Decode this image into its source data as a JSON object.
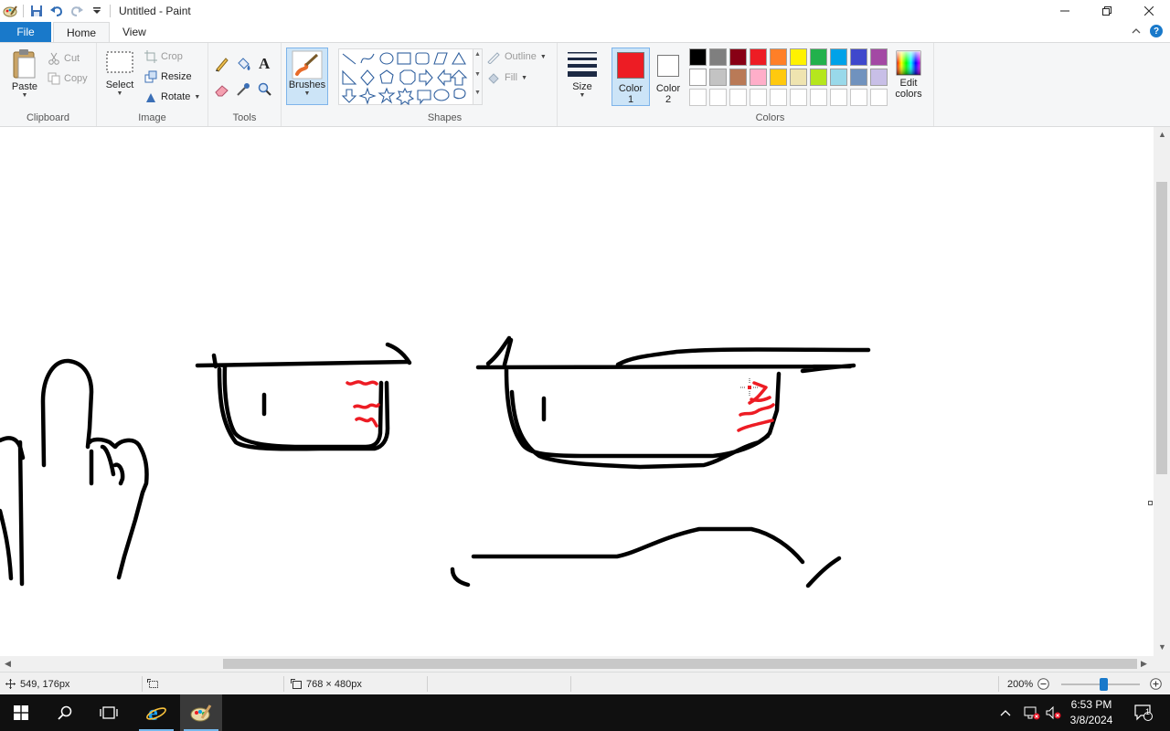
{
  "window": {
    "title": "Untitled - Paint"
  },
  "tabs": [
    "File",
    "Home",
    "View"
  ],
  "ribbon": {
    "clipboard": {
      "label": "Clipboard",
      "paste": "Paste",
      "cut": "Cut",
      "copy": "Copy"
    },
    "image": {
      "label": "Image",
      "select": "Select",
      "crop": "Crop",
      "resize": "Resize",
      "rotate": "Rotate"
    },
    "tools": {
      "label": "Tools"
    },
    "brushes": {
      "label": "Brushes"
    },
    "shapes": {
      "label": "Shapes",
      "outline": "Outline",
      "fill": "Fill"
    },
    "size": {
      "label": "Size"
    },
    "colors": {
      "label": "Colors",
      "color1": "Color 1",
      "color1_line1": "Color",
      "color1_line2": "1",
      "color2_line1": "Color",
      "color2_line2": "2",
      "color1_value": "#ed1c24",
      "color2_value": "#ffffff",
      "edit_line1": "Edit",
      "edit_line2": "colors",
      "palette_row1": [
        "#000000",
        "#7f7f7f",
        "#880015",
        "#ed1c24",
        "#ff7f27",
        "#fff200",
        "#22b14c",
        "#00a2e8",
        "#3f48cc",
        "#a349a4"
      ],
      "palette_row2": [
        "#ffffff",
        "#c3c3c3",
        "#b97a57",
        "#ffaec9",
        "#ffc90e",
        "#efe4b0",
        "#b5e61d",
        "#99d9ea",
        "#7092be",
        "#c8bfe7"
      ],
      "palette_row3": [
        "#ffffff",
        "#ffffff",
        "#ffffff",
        "#ffffff",
        "#ffffff",
        "#ffffff",
        "#ffffff",
        "#ffffff",
        "#ffffff",
        "#ffffff"
      ]
    }
  },
  "status": {
    "cursor_pos": "549, 176px",
    "canvas_size": "768 × 480px",
    "zoom": "200%",
    "zoom_level_fraction": 0.55
  },
  "taskbar": {
    "time": "6:53 PM",
    "date": "3/8/2024",
    "notification_count": "1"
  },
  "colors": {
    "accent": "#1979ca",
    "ribbon_bg": "#f5f6f7",
    "ink": "#000000",
    "ink_red": "#ed1c24"
  }
}
